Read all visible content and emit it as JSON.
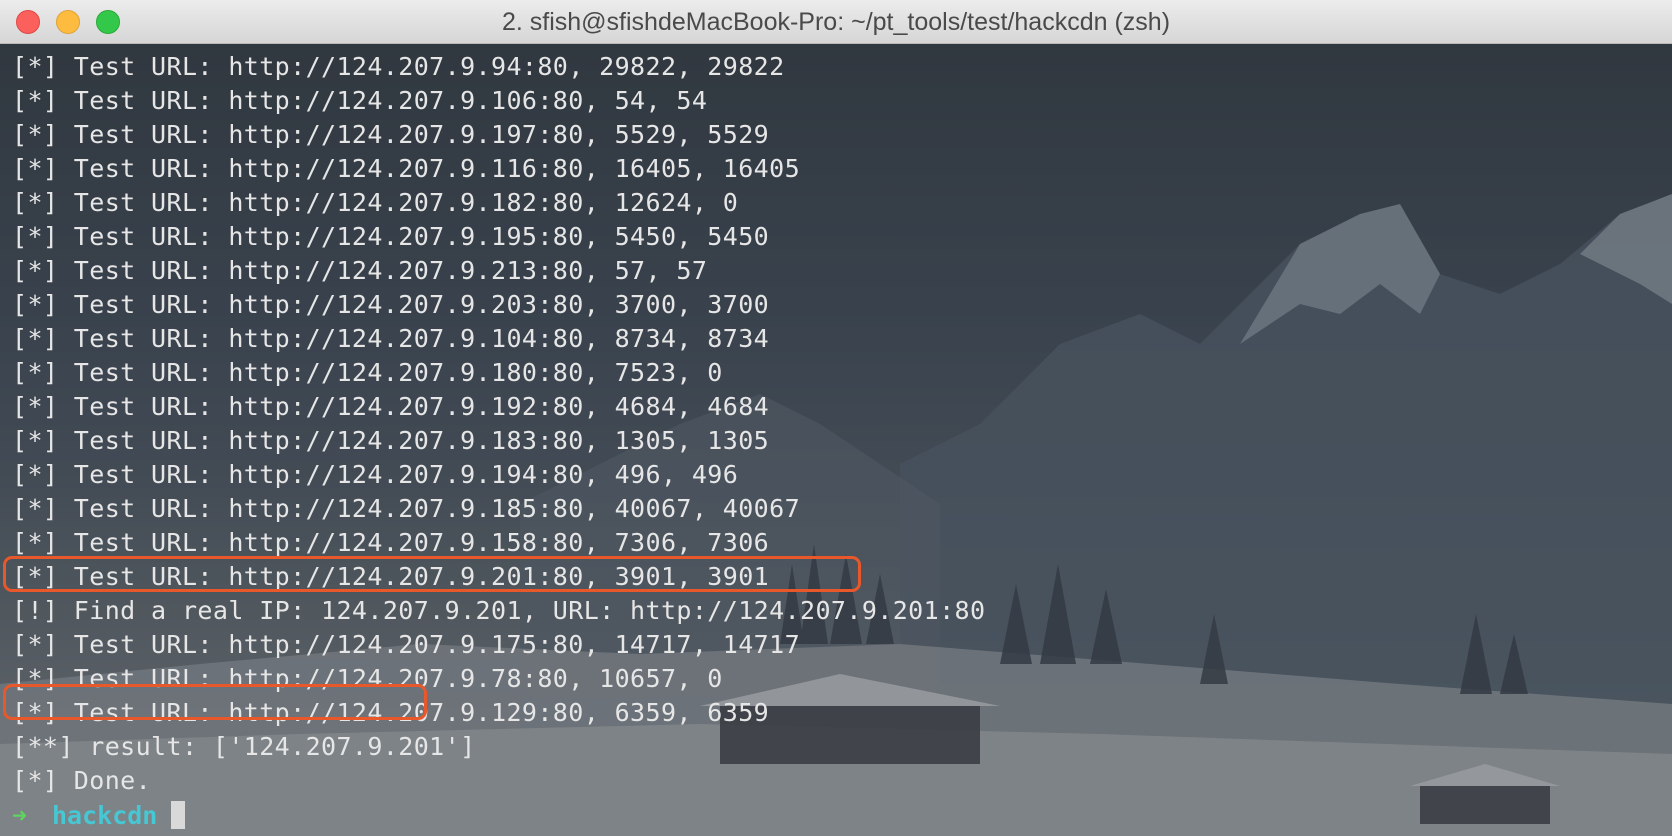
{
  "window": {
    "title": "2. sfish@sfishdeMacBook-Pro: ~/pt_tools/test/hackcdn (zsh)"
  },
  "terminal": {
    "lines": [
      "[*] Test URL: http://124.207.9.94:80, 29822, 29822",
      "[*] Test URL: http://124.207.9.106:80, 54, 54",
      "[*] Test URL: http://124.207.9.197:80, 5529, 5529",
      "[*] Test URL: http://124.207.9.116:80, 16405, 16405",
      "[*] Test URL: http://124.207.9.182:80, 12624, 0",
      "[*] Test URL: http://124.207.9.195:80, 5450, 5450",
      "[*] Test URL: http://124.207.9.213:80, 57, 57",
      "[*] Test URL: http://124.207.9.203:80, 3700, 3700",
      "[*] Test URL: http://124.207.9.104:80, 8734, 8734",
      "[*] Test URL: http://124.207.9.180:80, 7523, 0",
      "[*] Test URL: http://124.207.9.192:80, 4684, 4684",
      "[*] Test URL: http://124.207.9.183:80, 1305, 1305",
      "[*] Test URL: http://124.207.9.194:80, 496, 496",
      "[*] Test URL: http://124.207.9.185:80, 40067, 40067",
      "[*] Test URL: http://124.207.9.158:80, 7306, 7306",
      "[*] Test URL: http://124.207.9.201:80, 3901, 3901",
      "[!] Find a real IP: 124.207.9.201, URL: http://124.207.9.201:80",
      "[*] Test URL: http://124.207.9.175:80, 14717, 14717",
      "[*] Test URL: http://124.207.9.78:80, 10657, 0",
      "[*] Test URL: http://124.207.9.129:80, 6359, 6359",
      "[**] result: ['124.207.9.201']",
      "[*] Done."
    ],
    "prompt": {
      "arrow": "➜",
      "directory": "hackcdn"
    }
  },
  "colors": {
    "highlight_border": "#e8582b",
    "prompt_arrow": "#5fd35f",
    "prompt_dir": "#46c7d4"
  }
}
